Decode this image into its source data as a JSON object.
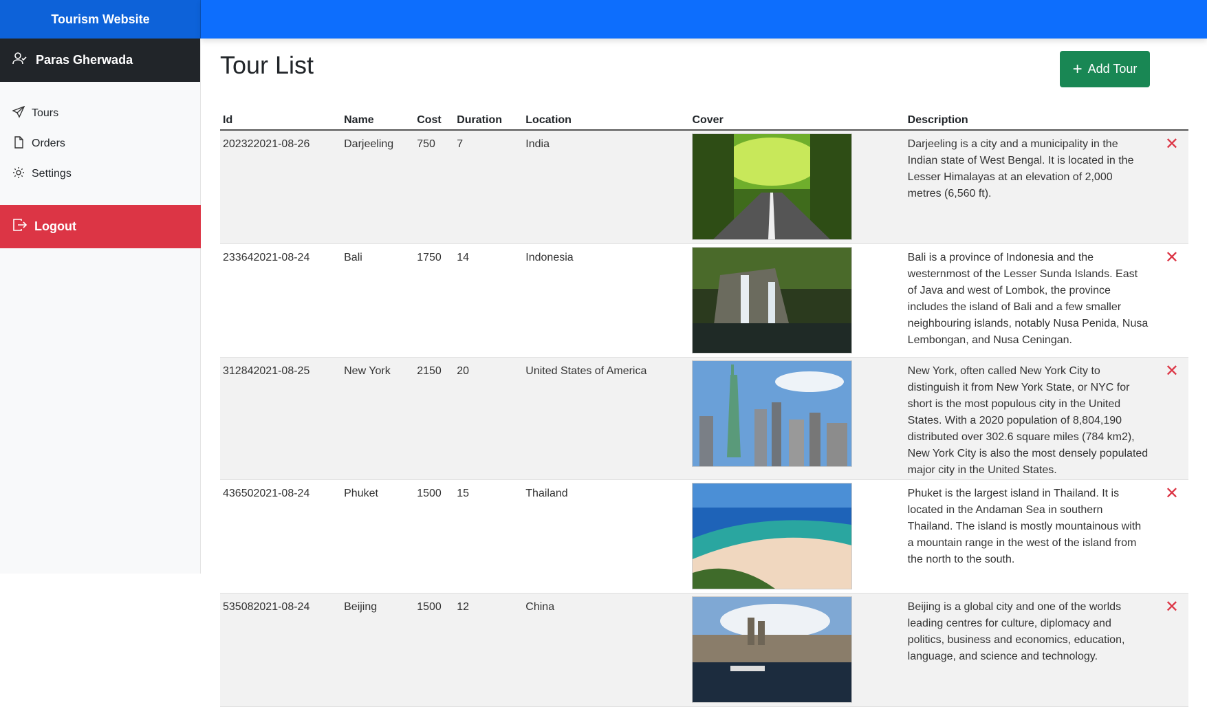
{
  "app": {
    "brand": "Tourism Website"
  },
  "user": {
    "name": "Paras Gherwada"
  },
  "nav": [
    {
      "label": "Tours",
      "icon": "send-icon"
    },
    {
      "label": "Orders",
      "icon": "file-icon"
    },
    {
      "label": "Settings",
      "icon": "gear-icon"
    }
  ],
  "logout_label": "Logout",
  "page": {
    "title": "Tour List",
    "add_button": "Add Tour"
  },
  "table": {
    "headers": {
      "id": "Id",
      "name": "Name",
      "cost": "Cost",
      "duration": "Duration",
      "location": "Location",
      "cover": "Cover",
      "description": "Description"
    },
    "rows": [
      {
        "id": "202322021-08-26",
        "name": "Darjeeling",
        "cost": "750",
        "duration": "7",
        "location": "India",
        "description": "Darjeeling is a city and a municipality in the Indian state of West Bengal. It is located in the Lesser Himalayas at an elevation of 2,000 metres (6,560 ft)."
      },
      {
        "id": "233642021-08-24",
        "name": "Bali",
        "cost": "1750",
        "duration": "14",
        "location": "Indonesia",
        "description": "Bali is a province of Indonesia and the westernmost of the Lesser Sunda Islands. East of Java and west of Lombok, the province includes the island of Bali and a few smaller neighbouring islands, notably Nusa Penida, Nusa Lembongan, and Nusa Ceningan."
      },
      {
        "id": "312842021-08-25",
        "name": "New York",
        "cost": "2150",
        "duration": "20",
        "location": "United States of America",
        "description": "New York, often called New York City to distinguish it from New York State, or NYC for short is the most populous city in the United States. With a 2020 population of 8,804,190 distributed over 302.6 square miles (784 km2), New York City is also the most densely populated major city in the United States."
      },
      {
        "id": "436502021-08-24",
        "name": "Phuket",
        "cost": "1500",
        "duration": "15",
        "location": "Thailand",
        "description": "Phuket is the largest island in Thailand. It is located in the Andaman Sea in southern Thailand. The island is mostly mountainous with a mountain range in the west of the island from the north to the south."
      },
      {
        "id": "535082021-08-24",
        "name": "Beijing",
        "cost": "1500",
        "duration": "12",
        "location": "China",
        "description": "Beijing is a global city and one of the worlds leading centres for culture, diplomacy and politics, business and economics, education, language, and science and technology."
      }
    ]
  },
  "colors": {
    "primary": "#0d6efd",
    "brand": "#0d62d9",
    "success": "#198754",
    "danger": "#dc3545",
    "dark": "#212529"
  }
}
